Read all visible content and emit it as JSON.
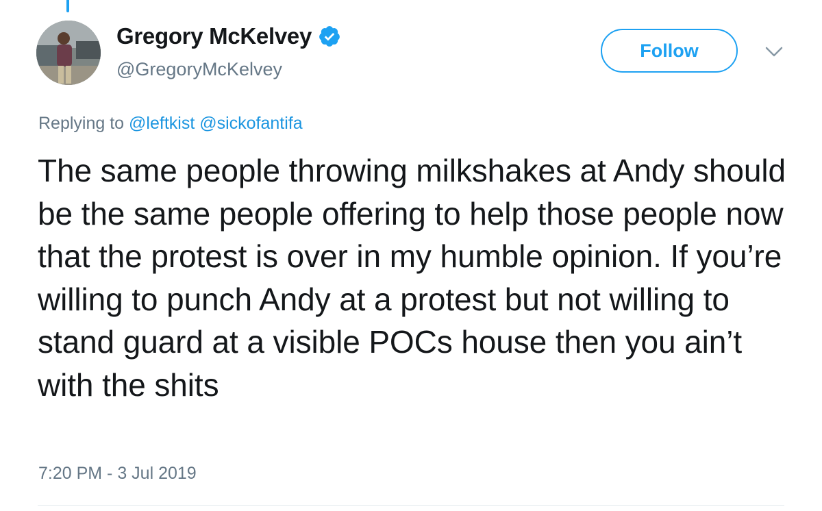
{
  "user": {
    "display_name": "Gregory McKelvey",
    "handle": "@GregoryMcKelvey",
    "verified": true
  },
  "follow_button": {
    "label": "Follow"
  },
  "reply": {
    "prefix": "Replying to",
    "mentions": [
      "@leftkist",
      "@sickofantifa"
    ]
  },
  "tweet": {
    "text": "The same people throwing milkshakes at Andy should be the same people offering to help those people now that the protest is over in my humble opinion. If you’re willing to punch Andy at a protest but not willing to stand guard at a visible POCs house then you ain’t with the shits",
    "timestamp": "7:20 PM - 3 Jul 2019"
  },
  "icons": {
    "verified": "verified-badge-icon",
    "menu": "chevron-down-icon"
  },
  "colors": {
    "accent": "#1da1f2",
    "mention": "#1b95e0",
    "secondary_text": "#657786",
    "primary_text": "#14171a"
  }
}
